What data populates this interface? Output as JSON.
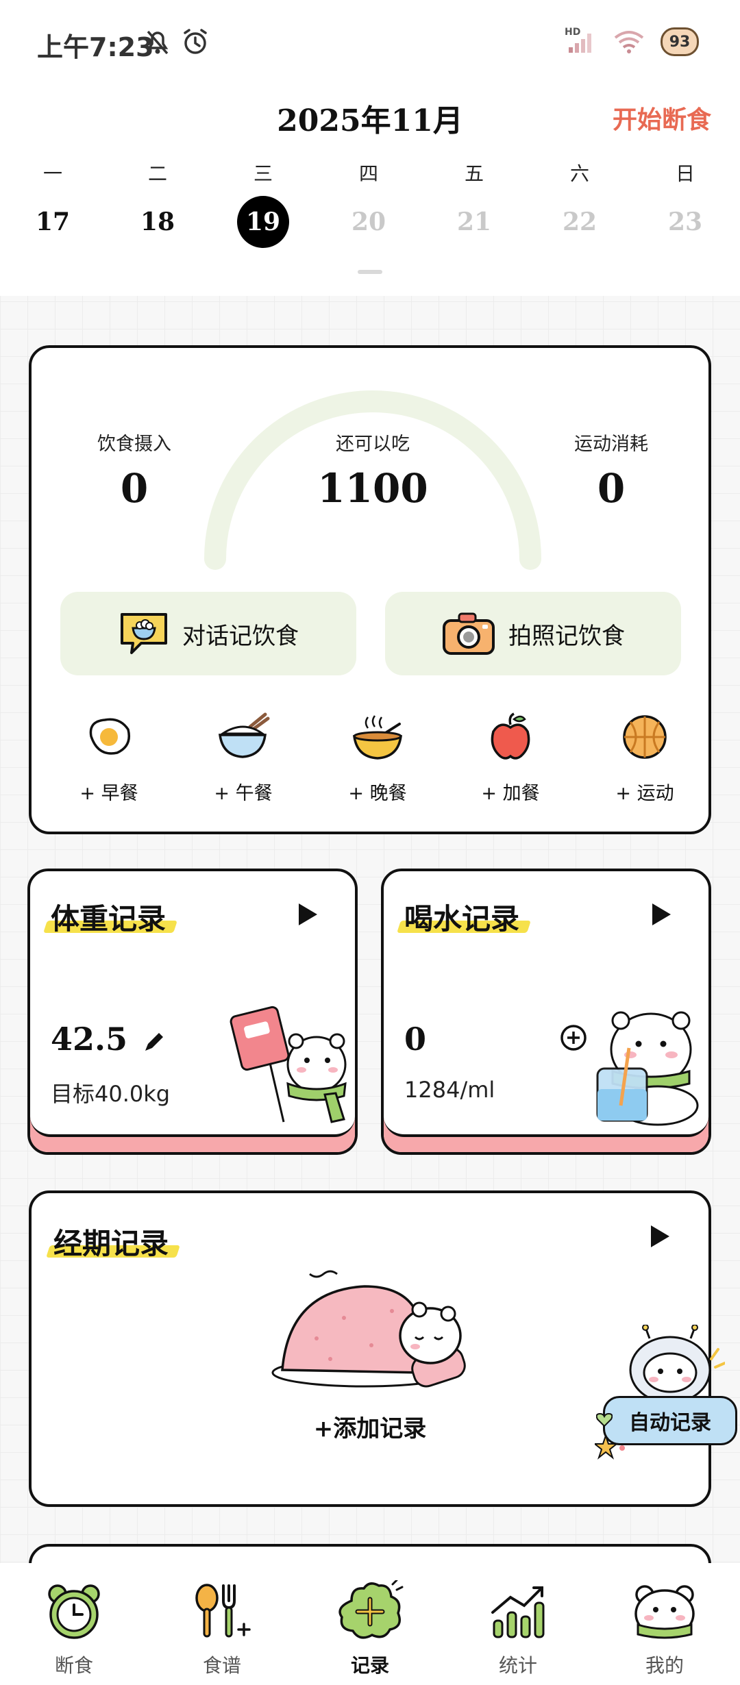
{
  "status_bar": {
    "time": "上午7:23",
    "network_label": "HD",
    "battery": "93"
  },
  "calendar": {
    "month_title": "2025年11月",
    "start_fast_label": "开始断食",
    "weekdays": [
      "一",
      "二",
      "三",
      "四",
      "五",
      "六",
      "日"
    ],
    "dates": [
      {
        "day": "17",
        "state": "past"
      },
      {
        "day": "18",
        "state": "past"
      },
      {
        "day": "19",
        "state": "today"
      },
      {
        "day": "20",
        "state": "future"
      },
      {
        "day": "21",
        "state": "future"
      },
      {
        "day": "22",
        "state": "future"
      },
      {
        "day": "23",
        "state": "future"
      }
    ]
  },
  "summary": {
    "intake_label": "饮食摄入",
    "intake_value": "0",
    "remaining_label": "还可以吃",
    "remaining_value": "1100",
    "burned_label": "运动消耗",
    "burned_value": "0",
    "chat_log_label": "对话记饮食",
    "photo_log_label": "拍照记饮食",
    "meals": [
      {
        "label": "+ 早餐",
        "icon": "egg-icon"
      },
      {
        "label": "+ 午餐",
        "icon": "rice-bowl-icon"
      },
      {
        "label": "+ 晚餐",
        "icon": "soup-bowl-icon"
      },
      {
        "label": "+ 加餐",
        "icon": "apple-icon"
      },
      {
        "label": "+ 运动",
        "icon": "basketball-icon"
      }
    ]
  },
  "weight": {
    "title": "体重记录",
    "value": "42.5",
    "target": "目标40.0kg"
  },
  "water": {
    "title": "喝水记录",
    "value": "0",
    "target": "1284/ml"
  },
  "period": {
    "title": "经期记录",
    "add_label": "+添加记录",
    "auto_label": "自动记录"
  },
  "nav": [
    {
      "label": "断食",
      "icon": "clock-icon",
      "active": false
    },
    {
      "label": "食谱",
      "icon": "utensils-icon",
      "active": false
    },
    {
      "label": "记录",
      "icon": "plus-cloud-icon",
      "active": true
    },
    {
      "label": "统计",
      "icon": "bar-chart-icon",
      "active": false
    },
    {
      "label": "我的",
      "icon": "bear-face-icon",
      "active": false
    }
  ],
  "colors": {
    "accent_orange": "#e86a53",
    "soft_green": "#eef4e5",
    "highlight_yellow": "#f6e14b",
    "pink_band": "#f7a8ab"
  }
}
